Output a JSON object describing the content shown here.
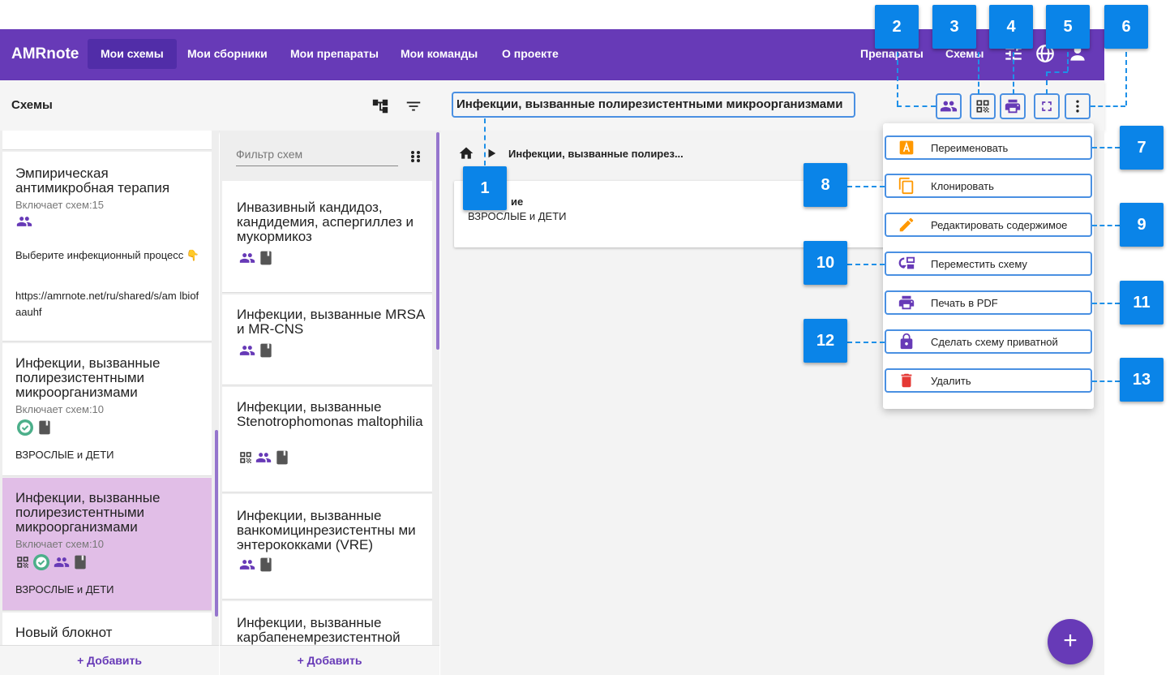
{
  "topbar": {
    "brand": "AMRnote",
    "tabs": [
      "Мои схемы",
      "Мои сборники",
      "Мои препараты",
      "Мои команды",
      "О проекте"
    ],
    "right_links": [
      "Препараты",
      "Схемы"
    ]
  },
  "toolbar": {
    "label": "Схемы",
    "scheme_title": "Инфекции, вызванные полирезистентными микроорганизмами"
  },
  "col1": {
    "cards": [
      {
        "title": "Эмпирическая антимикробная терапия",
        "sub": "Включает схем:15",
        "text1": "Выберите инфекционный процесс 👇",
        "text2": "https://amrnote.net/ru/shared/s/am lbiofaauhf"
      },
      {
        "title": "Инфекции, вызванные полирезистентными микроорганизмами",
        "sub": "Включает схем:10",
        "tag": "ВЗРОСЛЫЕ и ДЕТИ"
      },
      {
        "title": "Инфекции, вызванные полирезистентными микроорганизмами",
        "sub": "Включает схем:10",
        "tag": "ВЗРОСЛЫЕ и ДЕТИ"
      },
      {
        "title": "Новый блокнот"
      }
    ],
    "add_label": "+ Добавить"
  },
  "col2": {
    "filter_placeholder": "Фильтр схем",
    "cards": [
      {
        "title": "Инвазивный кандидоз, кандидемия, аспергиллез и мукормикоз"
      },
      {
        "title": "Инфекции, вызванные MRSA и MR-CNS"
      },
      {
        "title": "Инфекции, вызванные Stenotrophomonas maltophilia"
      },
      {
        "title": "Инфекции, вызванные ванкомицинрезистентны ми энтерококками (VRE)"
      },
      {
        "title": "Инфекции, вызванные карбапенемрезистентной"
      }
    ],
    "add_label": "+ Добавить"
  },
  "main": {
    "breadcrumb": "Инфекции, вызванные полирез...",
    "card_line1": "ие",
    "card_line2": "ВЗРОСЛЫЕ и ДЕТИ",
    "fab": "+"
  },
  "menu": {
    "items": [
      {
        "label": "Переименовать",
        "icon": "rename-icon"
      },
      {
        "label": "Клонировать",
        "icon": "copy-icon"
      },
      {
        "label": "Редактировать содержимое",
        "icon": "pencil-icon"
      },
      {
        "label": "Переместить схему",
        "icon": "move-icon"
      },
      {
        "label": "Печать в PDF",
        "icon": "print-icon"
      },
      {
        "label": "Сделать схему приватной",
        "icon": "lock-icon"
      },
      {
        "label": "Удалить",
        "icon": "trash-icon"
      }
    ]
  },
  "callouts": [
    "1",
    "2",
    "3",
    "4",
    "5",
    "6",
    "7",
    "8",
    "9",
    "10",
    "11",
    "12",
    "13"
  ],
  "colors": {
    "primary": "#673ab7",
    "selected": "#e1bee7",
    "callout": "#0a84e8",
    "highlight": "#4a90e2"
  }
}
